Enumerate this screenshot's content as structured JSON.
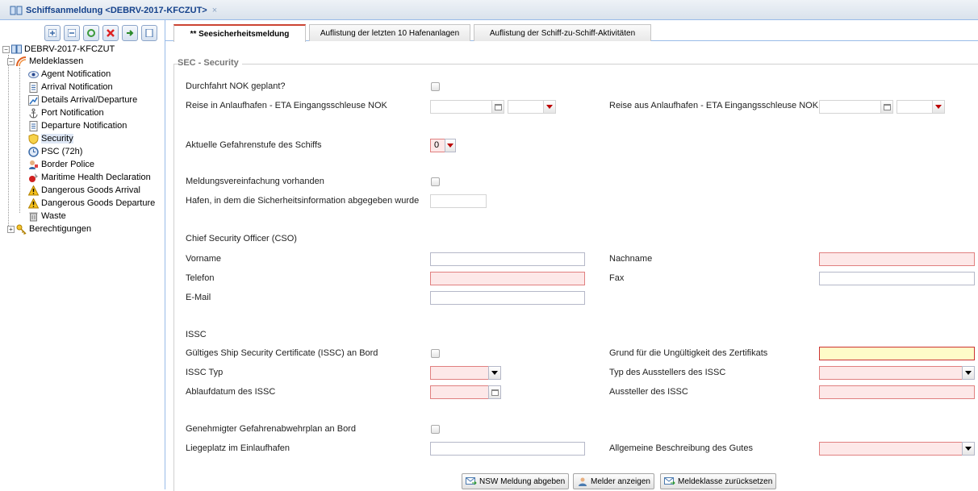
{
  "window": {
    "title": "Schiffsanmeldung <DEBRV-2017-KFCZUT>",
    "close": "×"
  },
  "tree": {
    "root": "DEBRV-2017-KFCZUT",
    "group": "Meldeklassen",
    "items": [
      {
        "label": "Agent Notification",
        "icon": "eye-icon"
      },
      {
        "label": "Arrival Notification",
        "icon": "document-icon"
      },
      {
        "label": "Details Arrival/Departure",
        "icon": "chart-icon"
      },
      {
        "label": "Port Notification",
        "icon": "anchor-icon"
      },
      {
        "label": "Departure Notification",
        "icon": "document-icon"
      },
      {
        "label": "Security",
        "icon": "shield-icon"
      },
      {
        "label": "PSC (72h)",
        "icon": "clock-icon"
      },
      {
        "label": "Border Police",
        "icon": "police-icon"
      },
      {
        "label": "Maritime Health Declaration",
        "icon": "health-icon"
      },
      {
        "label": "Dangerous Goods Arrival",
        "icon": "warning-icon"
      },
      {
        "label": "Dangerous Goods Departure",
        "icon": "warning-icon"
      },
      {
        "label": "Waste",
        "icon": "bin-icon"
      }
    ],
    "group2": "Berechtigungen"
  },
  "tabs": [
    {
      "label": "** Seesicherheitsmeldung"
    },
    {
      "label": "Auflistung der letzten 10 Hafenanlagen"
    },
    {
      "label": "Auflistung der Schiff-zu-Schiff-Aktivitäten"
    }
  ],
  "form": {
    "legend": "SEC - Security",
    "nok_planned": "Durchfahrt NOK geplant?",
    "eta_in": "Reise in Anlaufhafen - ETA Eingangsschleuse NOK",
    "eta_out": "Reise aus Anlaufhafen - ETA Eingangsschleuse NOK",
    "threat_level": "Aktuelle Gefahrenstufe des Schiffs",
    "threat_level_value": "0",
    "simplification": "Meldungsvereinfachung vorhanden",
    "port_info": "Hafen, in dem die Sicherheitsinformation abgegeben wurde",
    "cso_title": "Chief Security Officer (CSO)",
    "first_name": "Vorname",
    "last_name": "Nachname",
    "phone": "Telefon",
    "fax": "Fax",
    "email": "E-Mail",
    "issc_title": "ISSC",
    "issc_valid": "Gültiges Ship Security Certificate (ISSC) an Bord",
    "invalid_reason": "Grund für die Ungültigkeit des Zertifikats",
    "issc_type": "ISSC Typ",
    "issuer_type": "Typ des Ausstellers des ISSC",
    "issc_expiry": "Ablaufdatum des ISSC",
    "issc_issuer": "Aussteller des ISSC",
    "approved_plan": "Genehmigter Gefahrenabwehrplan an Bord",
    "berth": "Liegeplatz im Einlaufhafen",
    "goods_desc": "Allgemeine Beschreibung des Gutes"
  },
  "buttons": {
    "submit": "NSW Meldung abgeben",
    "show_reporter": "Melder anzeigen",
    "reset": "Meldeklasse zurücksetzen"
  }
}
